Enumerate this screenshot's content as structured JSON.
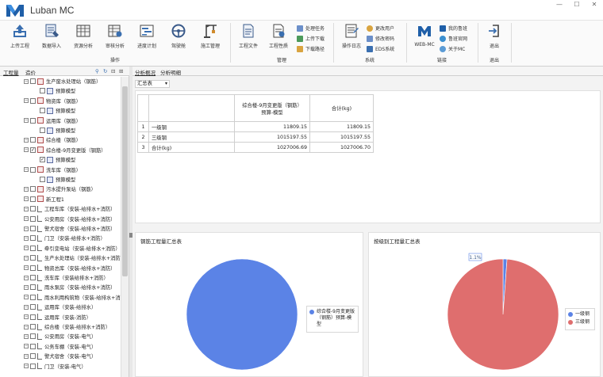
{
  "app": {
    "title": "Luban MC"
  },
  "window_controls": [
    "—",
    "☐",
    "✕"
  ],
  "ribbon": {
    "groups": [
      {
        "label": "操作",
        "buttons": [
          "上传工程",
          "数据导入",
          "资源分析",
          "审核分析",
          "进度计划",
          "驾驶舱",
          "施工管理"
        ]
      },
      {
        "label": "管理",
        "buttons": [
          "工程文件",
          "工程性质"
        ],
        "small": [
          "处理任务",
          "上传下载",
          "下载路径"
        ]
      },
      {
        "label": "系统",
        "buttons": [
          "操作日志"
        ],
        "small": [
          "更改用户",
          "修改密码",
          "EDS系统"
        ]
      },
      {
        "label": "链接",
        "buttons": [
          "WEB-MC"
        ],
        "small": [
          "我的鲁班",
          "鲁班官网",
          "关于MC"
        ]
      },
      {
        "label": "退出",
        "buttons": [
          "退出"
        ]
      }
    ]
  },
  "left_panel": {
    "tabs": [
      "工程量",
      "造价"
    ],
    "tree": [
      {
        "text": "生产废水处理站（钢筋）",
        "level": 0,
        "icon": "proj",
        "checked": false
      },
      {
        "text": "预算模型",
        "level": 1,
        "icon": "model",
        "checked": false
      },
      {
        "text": "物资库（钢筋）",
        "level": 0,
        "icon": "proj",
        "checked": false
      },
      {
        "text": "预算模型",
        "level": 1,
        "icon": "model",
        "checked": false
      },
      {
        "text": "运用库（钢筋）",
        "level": 0,
        "icon": "proj",
        "checked": false
      },
      {
        "text": "预算模型",
        "level": 1,
        "icon": "model",
        "checked": false
      },
      {
        "text": "综合楼（钢筋）",
        "level": 0,
        "icon": "proj",
        "checked": false
      },
      {
        "text": "综合楼-9月变更版（钢筋）",
        "level": 0,
        "icon": "proj",
        "checked": true
      },
      {
        "text": "预算模型",
        "level": 1,
        "icon": "model",
        "checked": true
      },
      {
        "text": "洗车库（钢筋）",
        "level": 0,
        "icon": "proj",
        "checked": false
      },
      {
        "text": "预算模型",
        "level": 1,
        "icon": "model",
        "checked": false
      },
      {
        "text": "污水提升泵站（钢筋）",
        "level": 0,
        "icon": "proj",
        "checked": false
      },
      {
        "text": "新工程1",
        "level": 0,
        "icon": "proj",
        "checked": false
      },
      {
        "text": "工程车库（安装-给排水+消防）",
        "level": 0,
        "icon": "mep",
        "checked": false
      },
      {
        "text": "公安用房（安装-给排水+消防）",
        "level": 0,
        "icon": "mep",
        "checked": false
      },
      {
        "text": "警犬宿舍（安装-给排水+消防）",
        "level": 0,
        "icon": "mep",
        "checked": false
      },
      {
        "text": "门卫（安装-给排水+消防）",
        "level": 0,
        "icon": "mep",
        "checked": false
      },
      {
        "text": "牵引变电站（安装-给排水+消防）",
        "level": 0,
        "icon": "mep",
        "checked": false
      },
      {
        "text": "生产水处理站（安装-给排水+消防）",
        "level": 0,
        "icon": "mep",
        "checked": false
      },
      {
        "text": "物资总库（安装-给排水+消防）",
        "level": 0,
        "icon": "mep",
        "checked": false
      },
      {
        "text": "洗车库（安装给排水+消防）",
        "level": 0,
        "icon": "mep",
        "checked": false
      },
      {
        "text": "雨水泵房（安装-给排水+消防）",
        "level": 0,
        "icon": "mep",
        "checked": false
      },
      {
        "text": "雨水利用构筑物（安装-给排水+消",
        "level": 0,
        "icon": "mep",
        "checked": false
      },
      {
        "text": "运用库（安装-给排水）",
        "level": 0,
        "icon": "mep",
        "checked": false
      },
      {
        "text": "运用库（安装-消防）",
        "level": 0,
        "icon": "mep",
        "checked": false
      },
      {
        "text": "综合楼（安装-给排水+消防）",
        "level": 0,
        "icon": "mep",
        "checked": false
      },
      {
        "text": "公安用房（安装-电气）",
        "level": 0,
        "icon": "mep",
        "checked": false
      },
      {
        "text": "公务车棚（安装-电气）",
        "level": 0,
        "icon": "mep",
        "checked": false
      },
      {
        "text": "警犬宿舍（安装-电气）",
        "level": 0,
        "icon": "mep",
        "checked": false
      },
      {
        "text": "门卫（安装-电气）",
        "level": 0,
        "icon": "mep",
        "checked": false
      }
    ]
  },
  "right_panel": {
    "tabs": [
      "分析概况",
      "分析明细"
    ],
    "dropdown": "汇总表",
    "table": {
      "columns": [
        "综合楼-9月变更版（钢筋）\n预算-模型",
        "合计(kg)"
      ],
      "rows": [
        {
          "idx": "1",
          "name": "一级钢",
          "v1": "11809.15",
          "v2": "11809.15"
        },
        {
          "idx": "2",
          "name": "三级钢",
          "v1": "1015197.55",
          "v2": "1015197.55"
        },
        {
          "idx": "3",
          "name": "合计(kg)",
          "v1": "1027006.69",
          "v2": "1027006.70"
        }
      ]
    },
    "colors": {
      "blue": "#5b83e6",
      "red": "#df6e6e"
    }
  },
  "chart_data": [
    {
      "type": "pie",
      "title": "钢筋工程量汇总表",
      "categories": [
        "综合楼-9月变更版（钢筋）预算-模型"
      ],
      "values": [
        1027006.69
      ],
      "legend": "right"
    },
    {
      "type": "pie",
      "title": "按级别工程量汇总表",
      "categories": [
        "一级钢",
        "三级钢"
      ],
      "values": [
        11809.15,
        1015197.55
      ],
      "data_labels": [
        "1.1%",
        ""
      ],
      "legend": "right"
    }
  ]
}
